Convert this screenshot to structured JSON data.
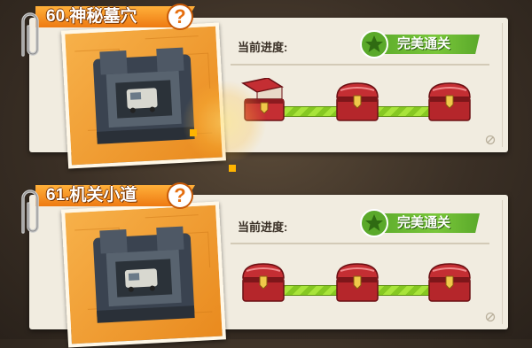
{
  "levels": [
    {
      "title": "60.神秘墓穴",
      "help_glyph": "?",
      "progress_label": "当前进度:",
      "status_badge": "完美通关",
      "chests": [
        {
          "state": "opened",
          "icon": "open-chest-icon"
        },
        {
          "state": "closed",
          "icon": "closed-chest-icon"
        },
        {
          "state": "closed",
          "icon": "closed-chest-icon"
        }
      ],
      "progress": 1.0
    },
    {
      "title": "61.机关小道",
      "help_glyph": "?",
      "progress_label": "当前进度:",
      "status_badge": "完美通关",
      "chests": [
        {
          "state": "closed",
          "icon": "closed-chest-icon"
        },
        {
          "state": "closed",
          "icon": "closed-chest-icon"
        },
        {
          "state": "closed",
          "icon": "closed-chest-icon"
        }
      ],
      "progress": 1.0
    }
  ],
  "colors": {
    "title_tag": "#ee7a12",
    "badge_green": "#79c63a",
    "track_green": "#a8e43a",
    "card_bg": "#f1ece0"
  }
}
